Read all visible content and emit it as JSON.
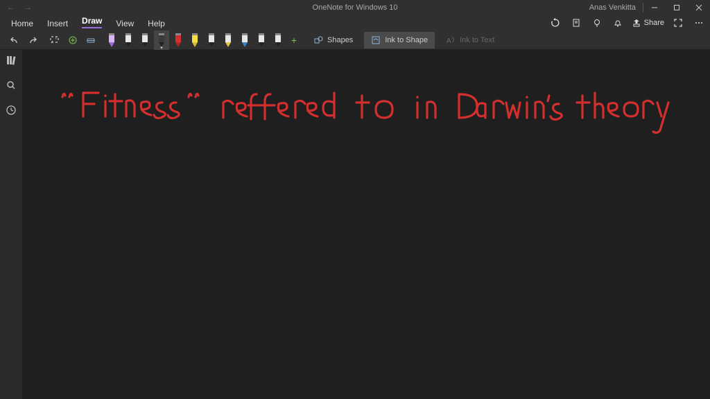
{
  "titlebar": {
    "title": "OneNote for Windows 10",
    "username": "Anas Venkitta"
  },
  "menu": {
    "home": "Home",
    "insert": "Insert",
    "draw": "Draw",
    "view": "View",
    "help": "Help"
  },
  "share": {
    "label": "Share"
  },
  "ribbon": {
    "shapes": "Shapes",
    "ink_to_shape": "Ink to Shape",
    "ink_to_text": "Ink to Text"
  },
  "pens": [
    {
      "body": "#d8b4f0",
      "tip": "#9a6dd7",
      "name": "pen-purple"
    },
    {
      "body": "#e8e8e8",
      "tip": "#222",
      "name": "pen-black"
    },
    {
      "body": "#e8e8e8",
      "tip": "#222",
      "name": "pen-black-thin"
    },
    {
      "body": "#3a3a3a",
      "tip": "#222",
      "name": "pen-dark",
      "selected": true
    },
    {
      "body": "#d32f2f",
      "tip": "#b02727",
      "name": "pen-red"
    },
    {
      "body": "#f4e041",
      "tip": "#d4c233",
      "name": "highlighter-yellow"
    },
    {
      "body": "#e8e8e8",
      "tip": "#222",
      "name": "pen-4"
    },
    {
      "body": "#e8e8e8",
      "tip": "#e0c84a",
      "name": "pen-yellow-tip"
    },
    {
      "body": "#e8e8e8",
      "tip": "#3b82c4",
      "name": "pen-blue-tip"
    },
    {
      "body": "#e8e8e8",
      "tip": "#222",
      "name": "pen-7"
    },
    {
      "body": "#e8e8e8",
      "tip": "#222",
      "name": "pen-8"
    }
  ],
  "handwriting": {
    "text": "\"Fitness\" reffered to in Darwin's theory",
    "color": "#d32f2f"
  }
}
